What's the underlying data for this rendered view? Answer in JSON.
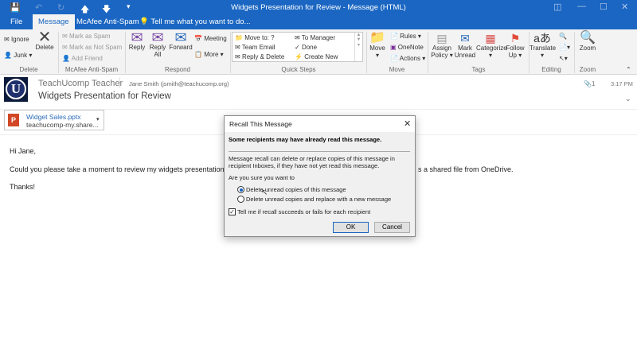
{
  "window": {
    "title": "Widgets Presentation for Review - Message (HTML)"
  },
  "tabs": [
    {
      "label": "File"
    },
    {
      "label": "Message"
    },
    {
      "label": "McAfee Anti-Spam"
    },
    {
      "label": "Tell me what you want to do..."
    }
  ],
  "ribbon": {
    "delete": {
      "ignore": "Ignore",
      "junk": "Junk",
      "delete": "Delete",
      "label": "Delete"
    },
    "mcafee": {
      "spam": "Mark as Spam",
      "not_spam": "Mark as Not Spam",
      "add_friend": "Add Friend",
      "label": "McAfee Anti-Spam"
    },
    "respond": {
      "reply": "Reply",
      "reply_all": "Reply All",
      "forward": "Forward",
      "meeting": "Meeting",
      "more": "More",
      "label": "Respond"
    },
    "quick_steps": {
      "items": [
        "Move to: ?",
        "Team Email",
        "Reply & Delete",
        "To Manager",
        "Done",
        "Create New"
      ],
      "label": "Quick Steps"
    },
    "move": {
      "move": "Move",
      "rules": "Rules",
      "onenote": "OneNote",
      "actions": "Actions",
      "label": "Move"
    },
    "tags": {
      "assign": "Assign Policy",
      "unread": "Mark Unread",
      "categorize": "Categorize",
      "follow": "Follow Up",
      "label": "Tags"
    },
    "editing": {
      "translate": "Translate",
      "label": "Editing"
    },
    "zoom": {
      "zoom": "Zoom",
      "label": "Zoom"
    }
  },
  "message": {
    "avatar_letter": "U",
    "sender": "TeachUcomp Teacher",
    "to": "Jane Smith (jsmith@teachucomp.org)",
    "subject": "Widgets Presentation for Review",
    "attachments_count": "1",
    "time": "3:17 PM",
    "attachment": {
      "name": "Widget Sales.pptx",
      "location": "teachucomp-my.share..."
    },
    "body": {
      "greeting": "Hi Jane,",
      "line_left": "Could you please take a moment to review my widgets presentation bef",
      "line_right": "s a shared file from OneDrive.",
      "closing": "Thanks!"
    }
  },
  "dialog": {
    "title": "Recall This Message",
    "warning": "Some recipients may have already read this message.",
    "info": "Message recall can delete or replace copies of this message in recipient Inboxes, if they have not yet read this message.",
    "question": "Are you sure you want to",
    "option1": "Delete unread copies of this message",
    "option2": "Delete unread copies and replace with a new message",
    "checkbox": "Tell me if recall succeeds or fails for each recipient",
    "ok": "OK",
    "cancel": "Cancel",
    "selected_option": 1,
    "checkbox_checked": true
  }
}
